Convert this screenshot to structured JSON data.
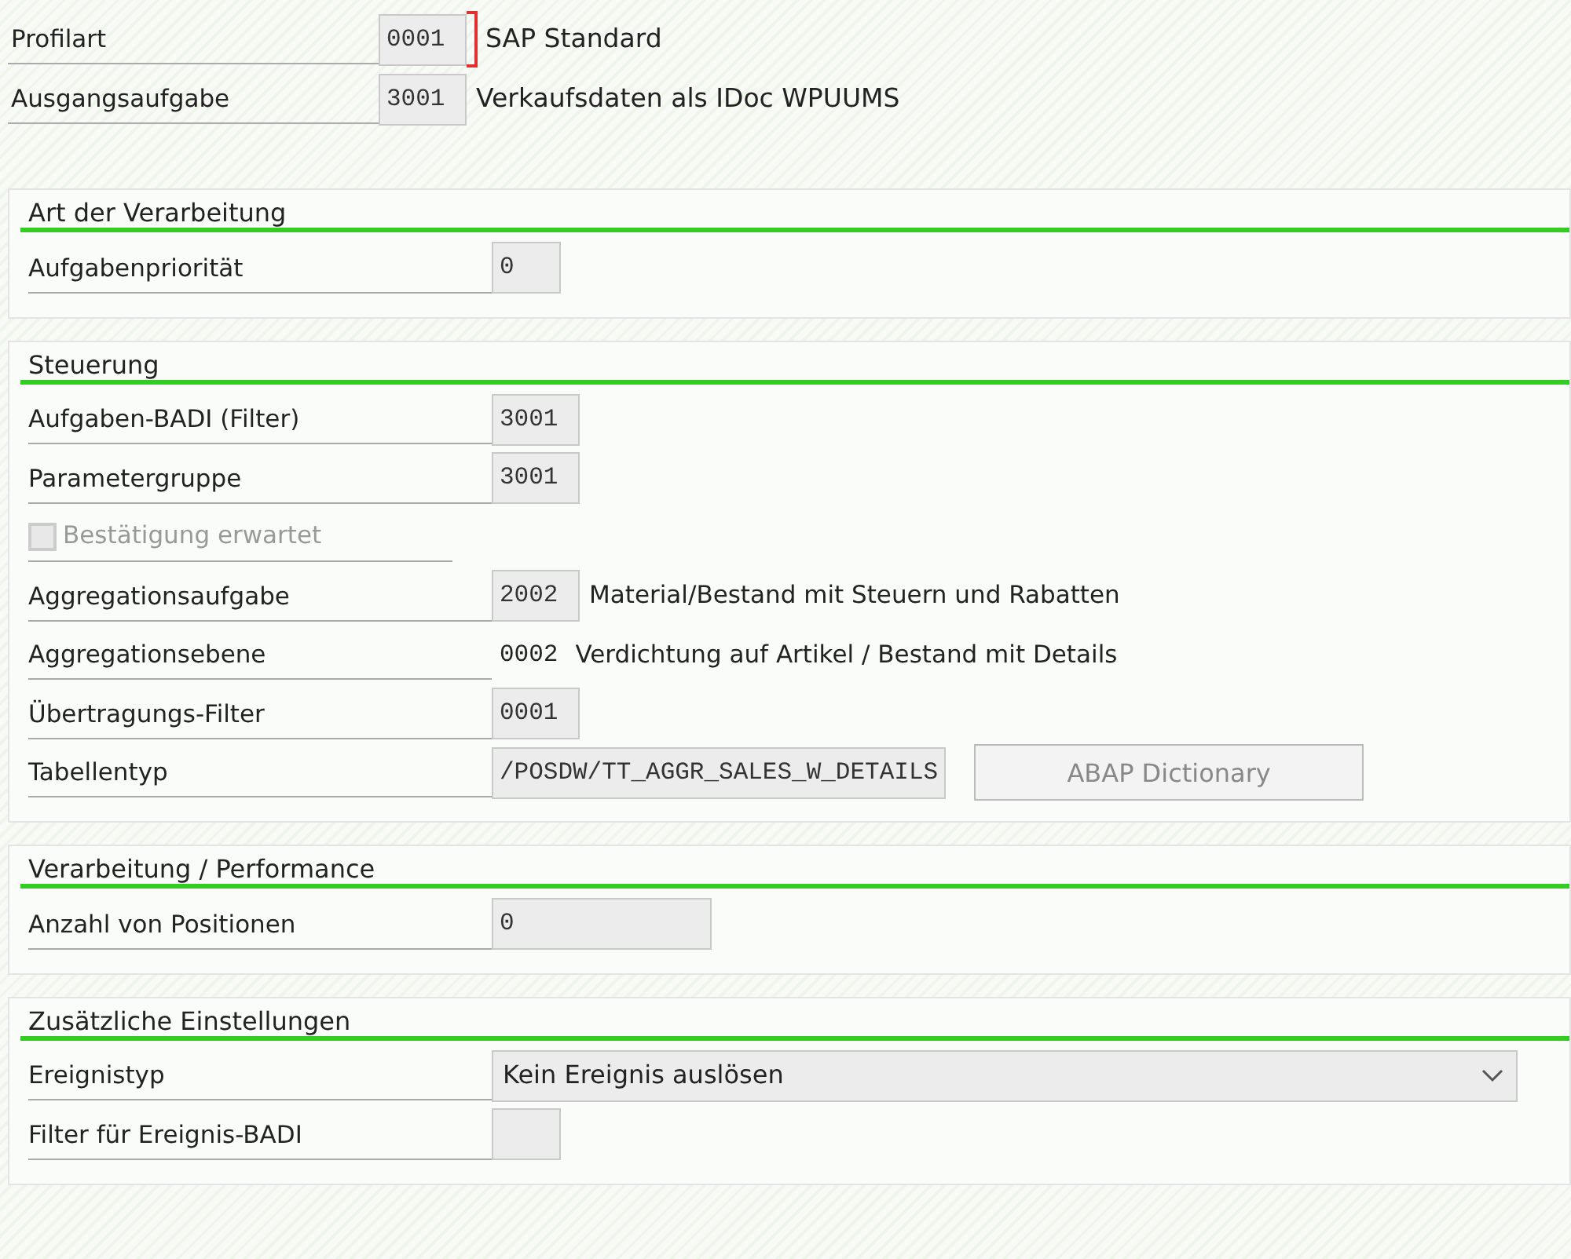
{
  "header_fields": [
    {
      "label": "Profilart",
      "value": "0001",
      "description": "SAP Standard",
      "required": true
    },
    {
      "label": "Ausgangsaufgabe",
      "value": "3001",
      "description": "Verkaufsdaten als IDoc WPUUMS",
      "required": false
    }
  ],
  "sections": [
    {
      "title": "Art der Verarbeitung",
      "rows": [
        {
          "kind": "field",
          "label": "Aufgabenpriorität",
          "value": "0"
        }
      ]
    },
    {
      "title": "Steuerung",
      "rows": [
        {
          "kind": "field",
          "label": "Aufgaben-BADI (Filter)",
          "value": "3001"
        },
        {
          "kind": "field",
          "label": "Parametergruppe",
          "value": "3001"
        },
        {
          "kind": "checkbox",
          "label": "Bestätigung erwartet",
          "checked": false,
          "disabled": true
        },
        {
          "kind": "field",
          "label": "Aggregationsaufgabe",
          "value": "2002",
          "description": "Material/Bestand mit Steuern und Rabatten"
        },
        {
          "kind": "display",
          "label": "Aggregationsebene",
          "value": "0002",
          "description": "Verdichtung auf Artikel / Bestand mit Details"
        },
        {
          "kind": "field",
          "label": "Übertragungs-Filter",
          "value": "0001"
        },
        {
          "kind": "field",
          "label": "Tabellentyp",
          "value": "/POSDW/TT_AGGR_SALES_W_DETAILS",
          "button": "ABAP Dictionary"
        }
      ]
    },
    {
      "title": "Verarbeitung / Performance",
      "rows": [
        {
          "kind": "wide-field",
          "label": "Anzahl von Positionen",
          "value": "0"
        }
      ]
    },
    {
      "title": "Zusätzliche Einstellungen",
      "rows": [
        {
          "kind": "dropdown",
          "label": "Ereignistyp",
          "value": "Kein Ereignis auslösen"
        },
        {
          "kind": "field",
          "label": "Filter für Ereignis-BADI",
          "value": ""
        }
      ]
    }
  ]
}
